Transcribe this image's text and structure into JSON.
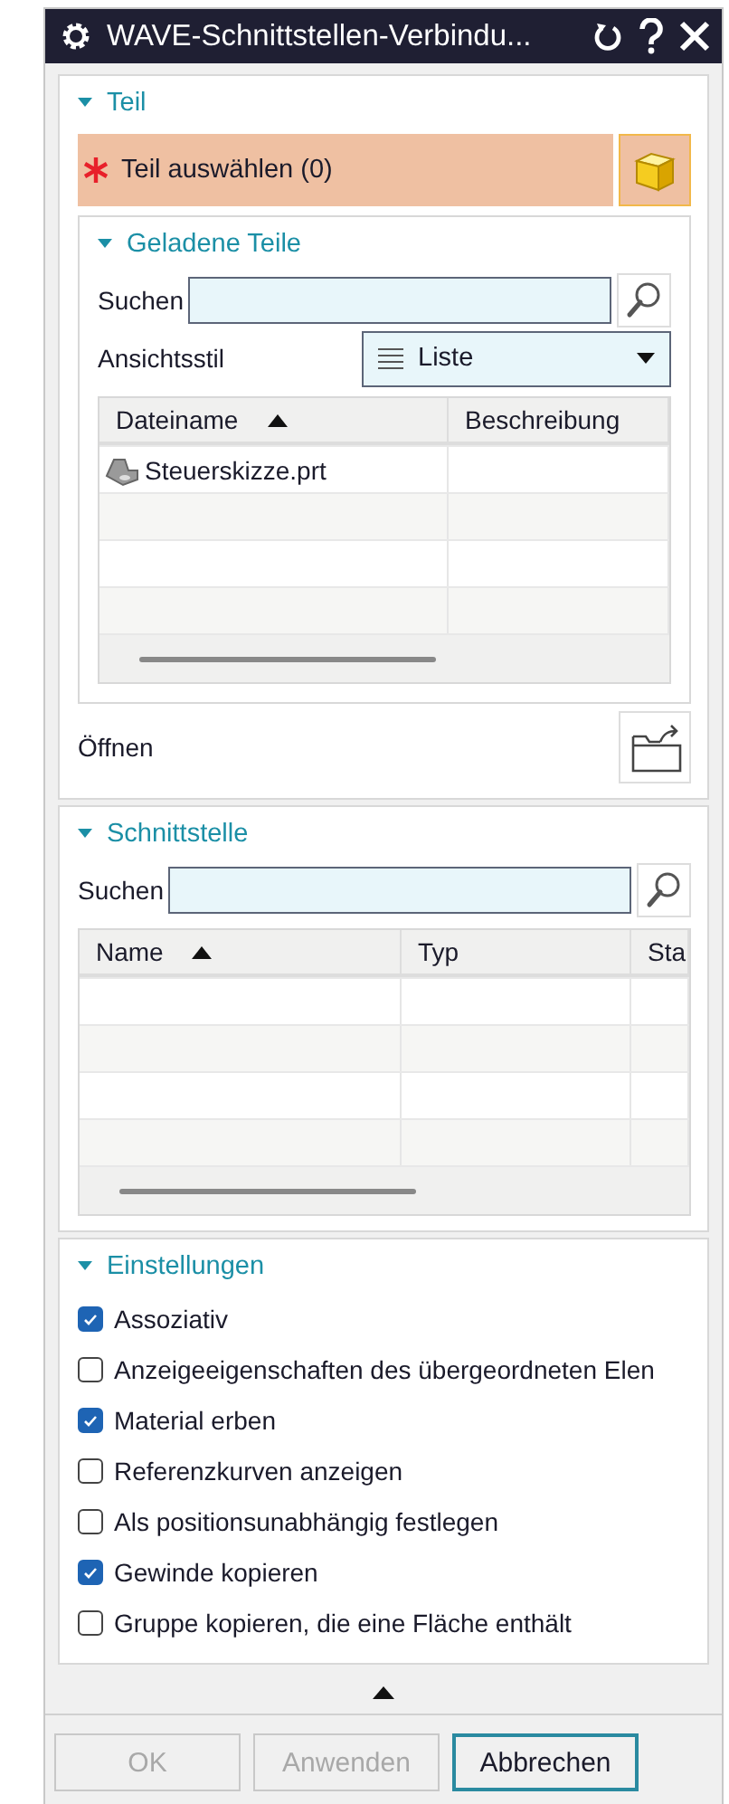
{
  "window": {
    "title": "WAVE-Schnittstellen-Verbindu..."
  },
  "teil": {
    "title": "Teil",
    "expanded": true,
    "selection": {
      "label": "Teil auswählen (0)",
      "required": true
    },
    "loaded_parts": {
      "title": "Geladene Teile",
      "expanded": true,
      "search": {
        "label": "Suchen"
      },
      "view_style": {
        "label": "Ansichtsstil",
        "value": "Liste"
      },
      "table": {
        "columns": [
          {
            "label": "Dateiname",
            "sorted": true
          },
          {
            "label": "Beschreibung",
            "sorted": false
          }
        ],
        "rows": [
          {
            "cells": [
              "Steuerskizze.prt",
              ""
            ]
          }
        ]
      }
    },
    "open": {
      "label": "Öffnen"
    }
  },
  "schnittstelle": {
    "title": "Schnittstelle",
    "expanded": true,
    "search": {
      "label": "Suchen"
    },
    "table": {
      "columns": [
        {
          "label": "Name",
          "sorted": true
        },
        {
          "label": "Typ",
          "sorted": false
        },
        {
          "label": "Sta"
        }
      ]
    }
  },
  "einstellungen": {
    "title": "Einstellungen",
    "expanded": true,
    "options": [
      {
        "label": "Assoziativ",
        "checked": true
      },
      {
        "label": "Anzeigeeigenschaften des übergeordneten Elen",
        "checked": false
      },
      {
        "label": "Material erben",
        "checked": true
      },
      {
        "label": "Referenzkurven anzeigen",
        "checked": false
      },
      {
        "label": "Als positionsunabhängig festlegen",
        "checked": false
      },
      {
        "label": "Gewinde kopieren",
        "checked": true
      },
      {
        "label": "Gruppe kopieren, die eine Fläche enthält",
        "checked": false
      }
    ]
  },
  "buttons": [
    {
      "label": "OK",
      "disabled": true,
      "primary": false
    },
    {
      "label": "Anwenden",
      "disabled": true,
      "primary": false
    },
    {
      "label": "Abbrechen",
      "disabled": false,
      "primary": true
    }
  ]
}
